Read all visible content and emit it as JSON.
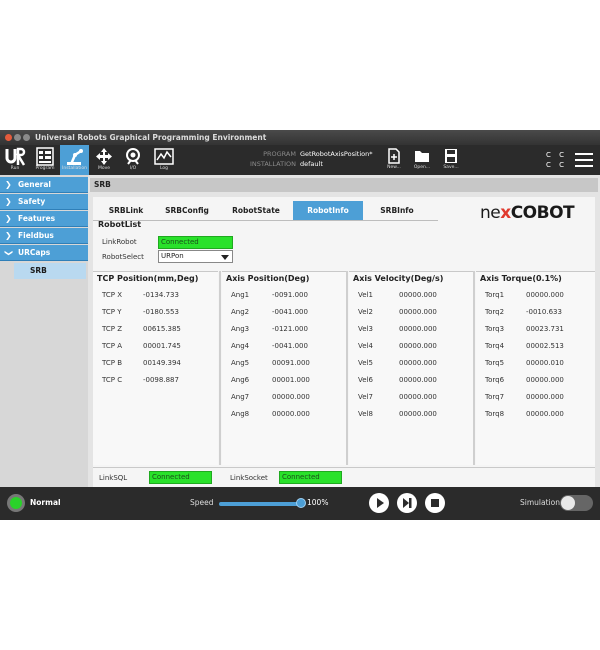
{
  "window": {
    "title": "Universal Robots Graphical Programming Environment"
  },
  "header": {
    "nav": [
      {
        "label": "Run"
      },
      {
        "label": "Program"
      },
      {
        "label": "Installation"
      },
      {
        "label": "Move"
      },
      {
        "label": "I/O"
      },
      {
        "label": "Log"
      }
    ],
    "program_label": "PROGRAM",
    "program_value": "GetRobotAxisPosition*",
    "installation_label": "INSTALLATION",
    "installation_value": "default",
    "file_buttons": [
      {
        "label": "New..."
      },
      {
        "label": "Open..."
      },
      {
        "label": "Save..."
      }
    ],
    "cc_top": "C C",
    "cc_bottom": "C C"
  },
  "sidebar": {
    "items": [
      {
        "label": "General"
      },
      {
        "label": "Safety"
      },
      {
        "label": "Features"
      },
      {
        "label": "Fieldbus"
      },
      {
        "label": "URCaps"
      }
    ],
    "sub_item": "SRB"
  },
  "breadcrumb": "SRB",
  "tabs": [
    {
      "label": "SRBLink"
    },
    {
      "label": "SRBConfig"
    },
    {
      "label": "RobotState"
    },
    {
      "label": "RobotInfo"
    },
    {
      "label": "SRBInfo"
    }
  ],
  "logo": {
    "pre": "ne",
    "x": "x",
    "post": "COBOT"
  },
  "robot_list": {
    "title": "RobotList",
    "link_label": "LinkRobot",
    "link_value": "Connected",
    "select_label": "RobotSelect",
    "select_value": "URPon"
  },
  "tcp": {
    "title": "TCP Position(mm,Deg)",
    "rows": [
      {
        "key": "TCP X",
        "value": "-0134.733"
      },
      {
        "key": "TCP Y",
        "value": "-0180.553"
      },
      {
        "key": "TCP Z",
        "value": "00615.385"
      },
      {
        "key": "TCP A",
        "value": "00001.745"
      },
      {
        "key": "TCP B",
        "value": "00149.394"
      },
      {
        "key": "TCP C",
        "value": "-0098.887"
      }
    ]
  },
  "axis_position": {
    "title": "Axis Position(Deg)",
    "rows": [
      {
        "key": "Ang1",
        "value": "-0091.000"
      },
      {
        "key": "Ang2",
        "value": "-0041.000"
      },
      {
        "key": "Ang3",
        "value": "-0121.000"
      },
      {
        "key": "Ang4",
        "value": "-0041.000"
      },
      {
        "key": "Ang5",
        "value": "00091.000"
      },
      {
        "key": "Ang6",
        "value": "00001.000"
      },
      {
        "key": "Ang7",
        "value": "00000.000"
      },
      {
        "key": "Ang8",
        "value": "00000.000"
      }
    ]
  },
  "axis_velocity": {
    "title": "Axis Velocity(Deg/s)",
    "rows": [
      {
        "key": "Vel1",
        "value": "00000.000"
      },
      {
        "key": "Vel2",
        "value": "00000.000"
      },
      {
        "key": "Vel3",
        "value": "00000.000"
      },
      {
        "key": "Vel4",
        "value": "00000.000"
      },
      {
        "key": "Vel5",
        "value": "00000.000"
      },
      {
        "key": "Vel6",
        "value": "00000.000"
      },
      {
        "key": "Vel7",
        "value": "00000.000"
      },
      {
        "key": "Vel8",
        "value": "00000.000"
      }
    ]
  },
  "axis_torque": {
    "title": "Axis Torque(0.1%)",
    "rows": [
      {
        "key": "Torq1",
        "value": "00000.000"
      },
      {
        "key": "Torq2",
        "value": "-0010.633"
      },
      {
        "key": "Torq3",
        "value": "00023.731"
      },
      {
        "key": "Torq4",
        "value": "00002.513"
      },
      {
        "key": "Torq5",
        "value": "00000.010"
      },
      {
        "key": "Torq6",
        "value": "00000.000"
      },
      {
        "key": "Torq7",
        "value": "00000.000"
      },
      {
        "key": "Torq8",
        "value": "00000.000"
      }
    ]
  },
  "links": {
    "sql_label": "LinkSQL",
    "sql_value": "Connected",
    "socket_label": "LinkSocket",
    "socket_value": "Connected"
  },
  "footer": {
    "status": "Normal",
    "speed_label": "Speed",
    "speed_value": "100%",
    "speed_fraction": 1.0,
    "simulation_label": "Simulation"
  },
  "colors": {
    "accent": "#4d9fd6",
    "connected": "#29e12a",
    "power": "#2ad12a",
    "dark": "#2b2b2b"
  }
}
